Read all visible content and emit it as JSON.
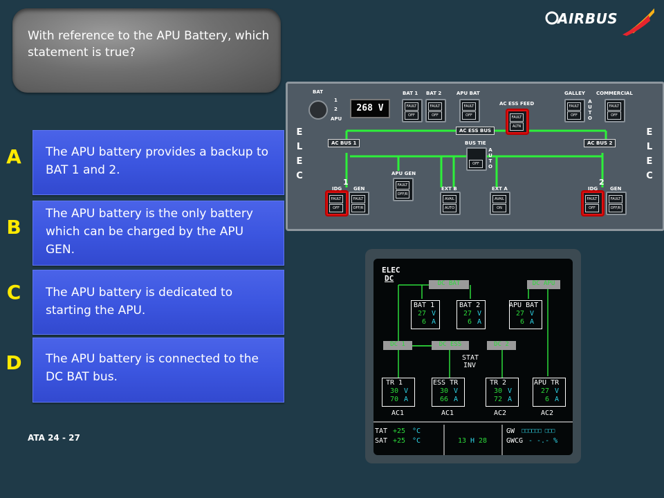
{
  "question": "With reference to the APU Battery, which statement is true?",
  "logo": {
    "text": "AIRBUS",
    "colors": [
      "#e7242d",
      "#f6b119"
    ]
  },
  "options": [
    {
      "letter": "A",
      "text": "The APU battery provides a backup to BAT 1 and 2."
    },
    {
      "letter": "B",
      "text": "The APU battery is the only battery which can be charged by the APU GEN."
    },
    {
      "letter": "C",
      "text": "The APU battery is dedicated to starting the APU."
    },
    {
      "letter": "D",
      "text": "The APU battery is connected to the DC BAT bus."
    }
  ],
  "footer": "ATA 24 - 27",
  "overhead": {
    "elec": [
      "E",
      "L",
      "E",
      "C"
    ],
    "bat_selector": {
      "label": "BAT",
      "pos1": "1",
      "pos2": "2",
      "pos3": "APU"
    },
    "voltage": "268 V",
    "labels": {
      "bat1": "BAT 1",
      "bat2": "BAT 2",
      "apu_bat": "APU BAT",
      "ac_ess_feed": "AC ESS FEED",
      "galley": "GALLEY",
      "commercial": "COMMERCIAL",
      "ac_ess_bus": "AC ESS BUS",
      "ac_bus_1": "AC BUS 1",
      "ac_bus_2": "AC BUS 2",
      "bus_tie": "BUS TIE",
      "auto": "A U T O",
      "apu_gen": "APU GEN",
      "ext_b": "EXT B",
      "ext_a": "EXT A",
      "idg": "IDG",
      "gen": "GEN",
      "one": "1",
      "two": "2"
    },
    "button_text": {
      "fault": "FAULT",
      "off": "OFF",
      "altn": "ALTN",
      "off_r": "OFF/R",
      "avail": "AVAIL",
      "auto": "AUTO",
      "on": "ON"
    }
  },
  "ecam": {
    "title1": "ELEC",
    "title2": "DC",
    "dc_bat": "DC BAT",
    "dc_apu": "DC APU",
    "dc1": "DC 1",
    "dc_ess": "DC ESS",
    "dc2": "DC 2",
    "stat": "STAT",
    "inv": "INV",
    "batteries": [
      {
        "name": "BAT 1",
        "volt": "27",
        "amp": "6"
      },
      {
        "name": "BAT 2",
        "volt": "27",
        "amp": "6"
      },
      {
        "name": "APU BAT",
        "volt": "27",
        "amp": "6"
      }
    ],
    "trs": [
      {
        "name": "TR 1",
        "volt": "30",
        "amp": "70",
        "ac": "AC1"
      },
      {
        "name": "ESS TR",
        "volt": "30",
        "amp": "66",
        "ac": "AC1"
      },
      {
        "name": "TR 2",
        "volt": "30",
        "amp": "72",
        "ac": "AC2"
      },
      {
        "name": "APU TR",
        "volt": "27",
        "amp": "6",
        "ac": "AC2"
      }
    ],
    "unit_v": "V",
    "unit_a": "A",
    "tat_label": "TAT",
    "tat": "+25",
    "sat_label": "SAT",
    "sat": "+25",
    "deg": "°C",
    "time_h": "13",
    "h": "H",
    "time_m": "28",
    "gw": "GW",
    "gwcg": "GWCG",
    "gw_val": "□□□□□□ □□□",
    "gwcg_val": "- -.-  %"
  }
}
